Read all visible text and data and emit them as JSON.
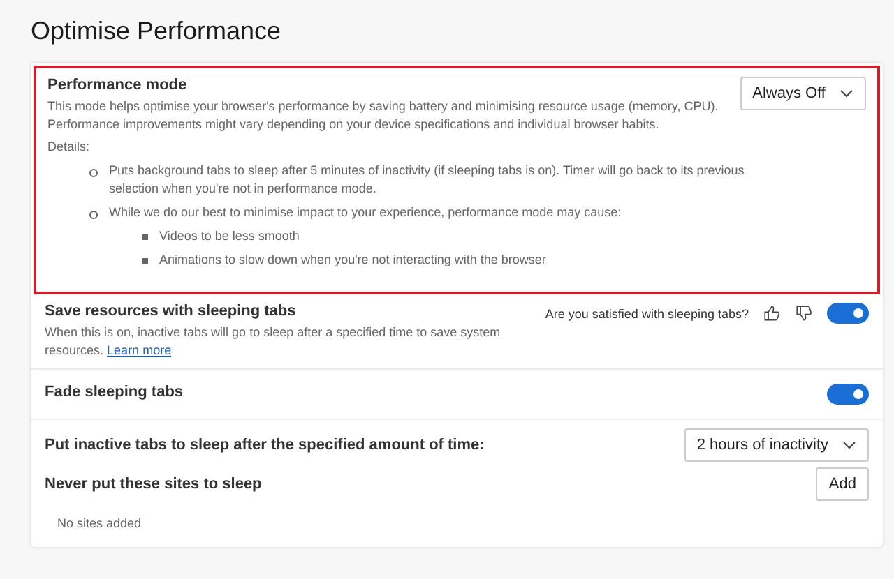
{
  "page_title": "Optimise Performance",
  "performance_mode": {
    "title": "Performance mode",
    "highlighted": true,
    "description": [
      "This mode helps optimise your browser's performance by saving battery and minimising resource usage (memory, CPU).",
      "Performance improvements might vary depending on your device specifications and individual browser habits."
    ],
    "details_label": "Details:",
    "dropdown": "Always Off",
    "bullets": [
      {
        "text": "Puts background tabs to sleep after 5 minutes of inactivity (if sleeping tabs is on). Timer will go back to its previous selection when you're not in performance mode."
      },
      {
        "text": "While we do our best to minimise impact to your experience, performance mode may cause:",
        "children": [
          {
            "text": "Videos to be less smooth"
          },
          {
            "text": "Animations to slow down when you're not interacting with the browser"
          }
        ]
      }
    ]
  },
  "sleeping_tabs": {
    "title": "Save resources with sleeping tabs",
    "description": "When this is on, inactive tabs will go to sleep after a specified time to save system resources.",
    "link": "Learn more",
    "feedback": "Are you satisfied with sleeping tabs?",
    "on": true
  },
  "fade": {
    "title": "Fade sleeping tabs",
    "on": true
  },
  "timeout": {
    "label": "Put inactive tabs to sleep after the specified amount of time:",
    "dropdown": "2 hours of inactivity"
  },
  "never_sleep": {
    "title": "Never put these sites to sleep",
    "button": "Add",
    "empty": "No sites added"
  }
}
